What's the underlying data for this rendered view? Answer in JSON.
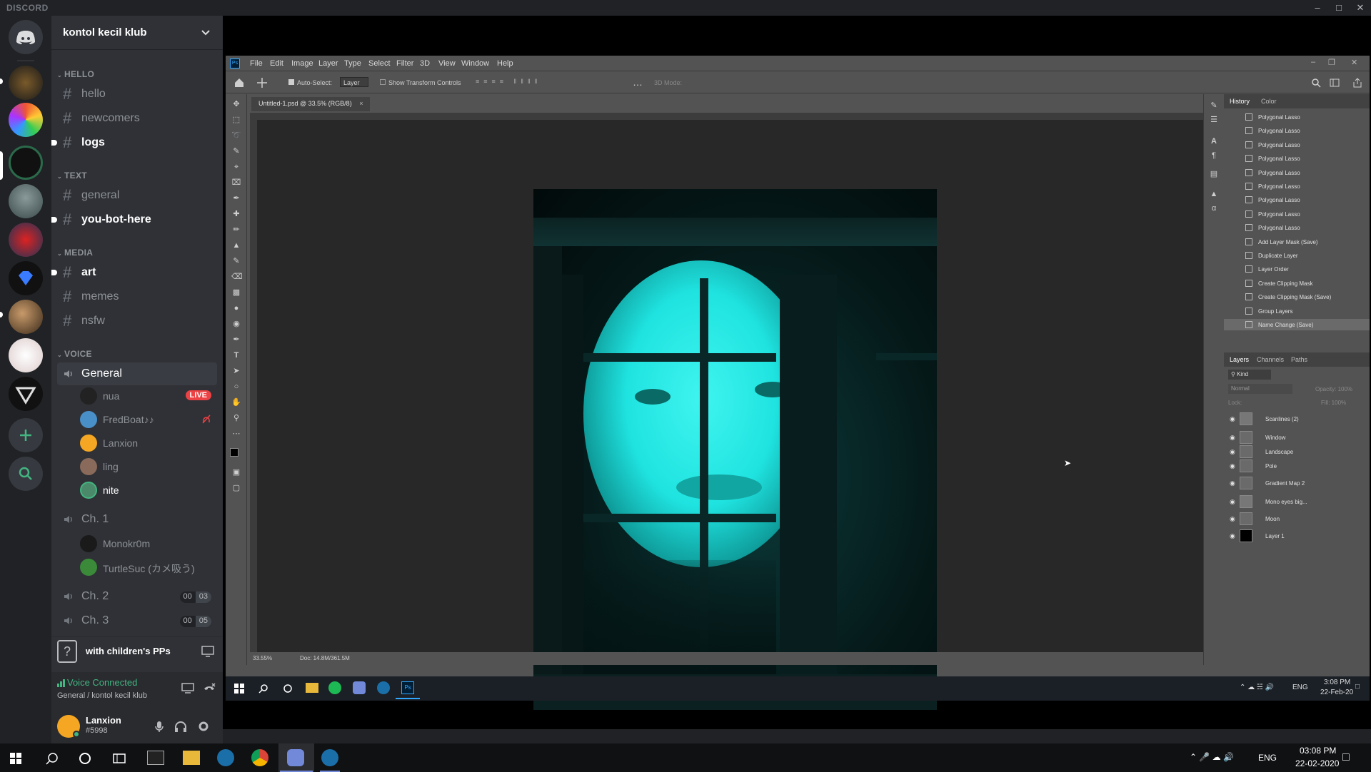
{
  "app": {
    "brand": "DISCORD"
  },
  "server": {
    "name": "kontol kecil klub"
  },
  "categories": {
    "hello": "HELLO",
    "text": "TEXT",
    "media": "MEDIA",
    "voice": "VOICE"
  },
  "channels": {
    "hello": "hello",
    "newcomers": "newcomers",
    "logs": "logs",
    "general": "general",
    "you_bot_here": "you-bot-here",
    "art": "art",
    "memes": "memes",
    "nsfw": "nsfw"
  },
  "voice": {
    "general": {
      "name": "General",
      "users": [
        {
          "name": "nua",
          "badge": "LIVE"
        },
        {
          "name": "FredBoat♪♪"
        },
        {
          "name": "Lanxion"
        },
        {
          "name": "ling"
        },
        {
          "name": "nite"
        }
      ]
    },
    "ch1": {
      "name": "Ch. 1",
      "users": [
        {
          "name": "Monokr0m"
        },
        {
          "name": "TurtleSuc (カメ吸う)"
        }
      ]
    },
    "ch2": {
      "name": "Ch. 2",
      "count_a": "00",
      "count_b": "03"
    },
    "ch3": {
      "name": "Ch. 3",
      "count_a": "00",
      "count_b": "05"
    }
  },
  "activity": {
    "title": "with children's PPs"
  },
  "voice_status": {
    "status": "Voice Connected",
    "location": "General / kontol kecil klub"
  },
  "user": {
    "name": "Lanxion",
    "tag": "#5998"
  },
  "photoshop": {
    "menu": [
      "File",
      "Edit",
      "Image",
      "Layer",
      "Type",
      "Select",
      "Filter",
      "3D",
      "View",
      "Window",
      "Help"
    ],
    "options": {
      "auto_select": "Auto-Select:",
      "layer_select": "Layer",
      "transform": "Show Transform Controls",
      "mode_3d": "3D Mode:"
    },
    "doc_tab": "Untitled-1.psd @ 33.5% (RGB/8)",
    "zoom": "33.55%",
    "doc_size": "Doc: 14.8M/361.5M",
    "history_tabs": [
      "History",
      "Color"
    ],
    "history": [
      "Polygonal Lasso",
      "Polygonal Lasso",
      "Polygonal Lasso",
      "Polygonal Lasso",
      "Polygonal Lasso",
      "Polygonal Lasso",
      "Polygonal Lasso",
      "Polygonal Lasso",
      "Polygonal Lasso",
      "Add Layer Mask (Save)",
      "Duplicate Layer",
      "Layer Order",
      "Create Clipping Mask",
      "Create Clipping Mask (Save)",
      "Group Layers",
      "Name Change (Save)"
    ],
    "layer_tabs": [
      "Layers",
      "Channels",
      "Paths"
    ],
    "layer_kind": "Kind",
    "layer_blend": "Normal",
    "layer_opacity": "Opacity: 100%",
    "layer_lock": "Lock:",
    "layer_fill": "Fill: 100%",
    "layers": [
      "Scanlines (2)",
      "Window",
      "Landscape",
      "Pole",
      "Gradient Map 2",
      "Mono eyes big...",
      "Moon",
      "Layer 1"
    ]
  },
  "inner_tray": {
    "lang": "ENG",
    "time": "3:08 PM",
    "date": "22-Feb-20"
  },
  "taskbar": {
    "lang": "ENG",
    "time": "03:08 PM",
    "date": "22-02-2020"
  },
  "colors": {
    "accent": "#7289da",
    "live": "#ed4245",
    "voice": "#43b581",
    "canvas_glow": "#1fe3e0"
  }
}
